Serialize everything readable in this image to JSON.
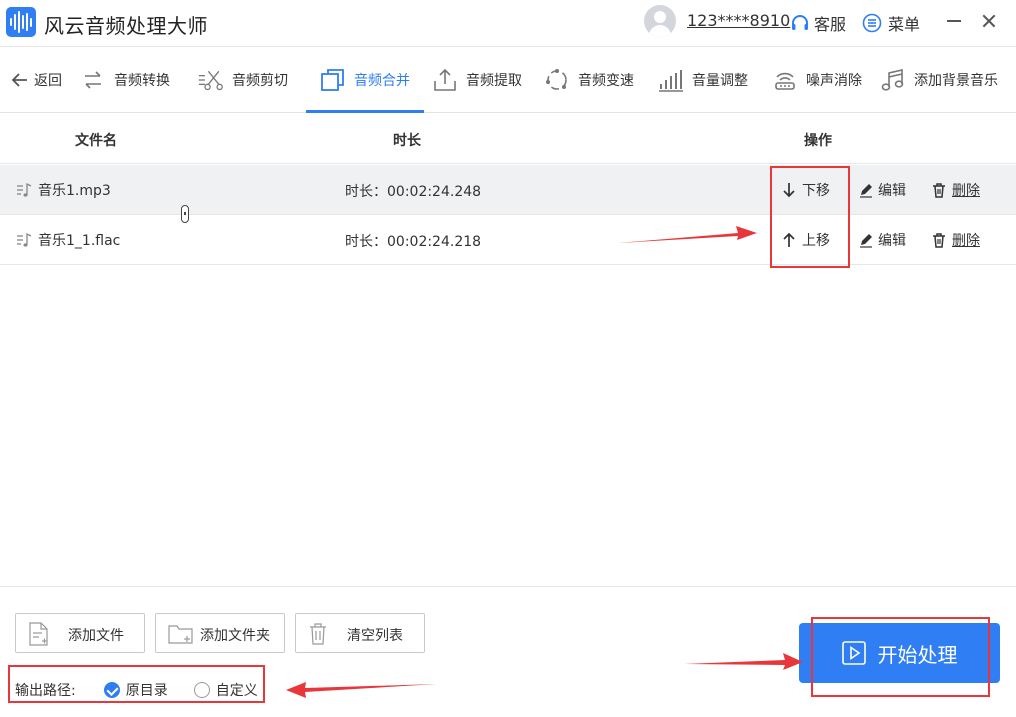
{
  "app": {
    "title": "风云音频处理大师"
  },
  "header": {
    "username": "123****8910",
    "service_label": "客服",
    "menu_label": "菜单"
  },
  "toolbar": {
    "back_label": "返回",
    "items": [
      {
        "label": "音频转换",
        "icon": "convert-icon"
      },
      {
        "label": "音频剪切",
        "icon": "scissors-icon"
      },
      {
        "label": "音频合并",
        "icon": "merge-icon",
        "active": true
      },
      {
        "label": "音频提取",
        "icon": "extract-icon"
      },
      {
        "label": "音频变速",
        "icon": "speed-icon"
      },
      {
        "label": "音量调整",
        "icon": "volume-bars-icon"
      },
      {
        "label": "噪声消除",
        "icon": "noise-icon"
      },
      {
        "label": "添加背景音乐",
        "icon": "music-note-icon"
      }
    ]
  },
  "table": {
    "columns": {
      "name": "文件名",
      "duration": "时长",
      "actions": "操作"
    },
    "rows": [
      {
        "name": "音乐1.mp3",
        "duration": "时长：00:02:24.248",
        "move": "下移",
        "edit": "编辑",
        "delete": "删除"
      },
      {
        "name": "音乐1_1.flac",
        "duration": "时长：00:02:24.218",
        "move": "上移",
        "edit": "编辑",
        "delete": "删除"
      }
    ]
  },
  "bottom": {
    "add_file": "添加文件",
    "add_folder": "添加文件夹",
    "clear_list": "清空列表",
    "output_label": "输出路径:",
    "opt_original": "原目录",
    "opt_custom": "自定义",
    "selected_option": "原目录",
    "start_label": "开始处理"
  },
  "colors": {
    "accent": "#2f7ef3",
    "annotation": "#e8373a",
    "selected_row": "#f0f1f3"
  }
}
